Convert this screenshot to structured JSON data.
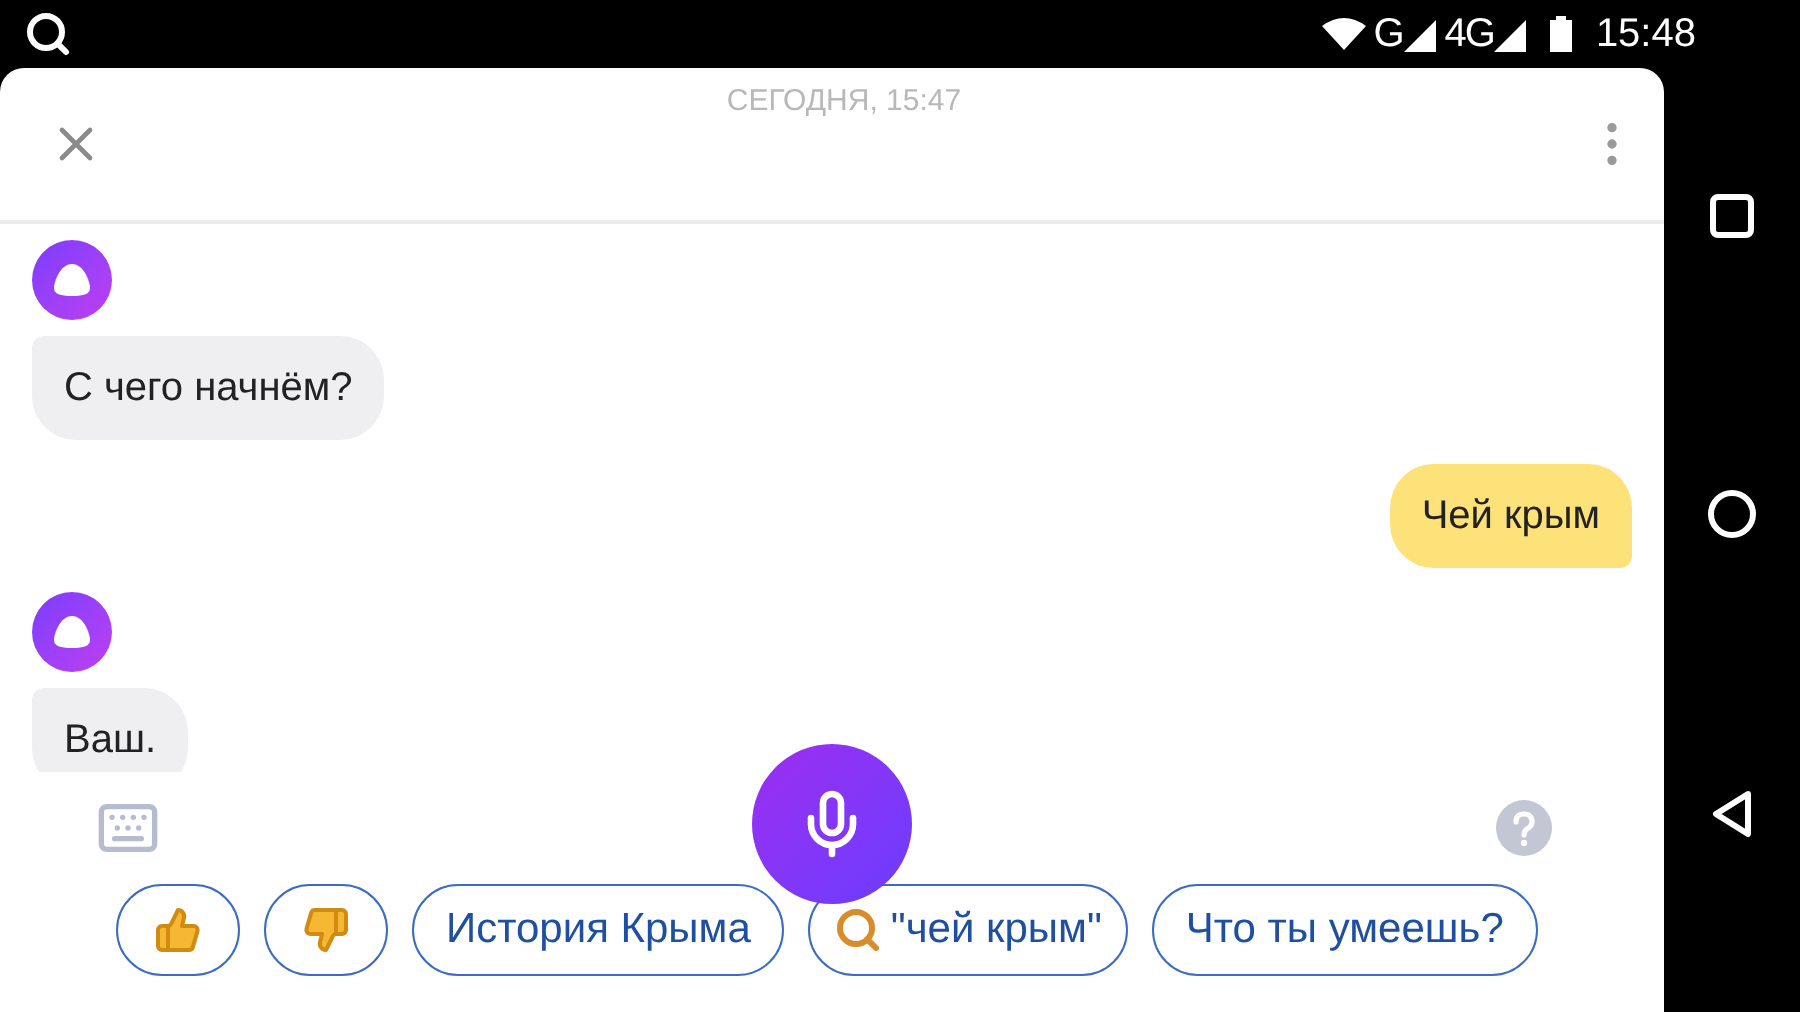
{
  "status_bar": {
    "network_labels": [
      "G",
      "4G"
    ],
    "time": "15:48"
  },
  "header": {
    "date_label": "СЕГОДНЯ, 15:47"
  },
  "messages": [
    {
      "kind": "assistant",
      "text": "С чего начнём?"
    },
    {
      "kind": "user",
      "text": "Чей крым"
    },
    {
      "kind": "assistant",
      "text": "Ваш."
    }
  ],
  "suggestions": [
    {
      "kind": "like"
    },
    {
      "kind": "dislike"
    },
    {
      "kind": "text",
      "label": "История Крыма"
    },
    {
      "kind": "search",
      "label": "\"чей крым\""
    },
    {
      "kind": "text",
      "label": "Что ты умеешь?"
    }
  ]
}
